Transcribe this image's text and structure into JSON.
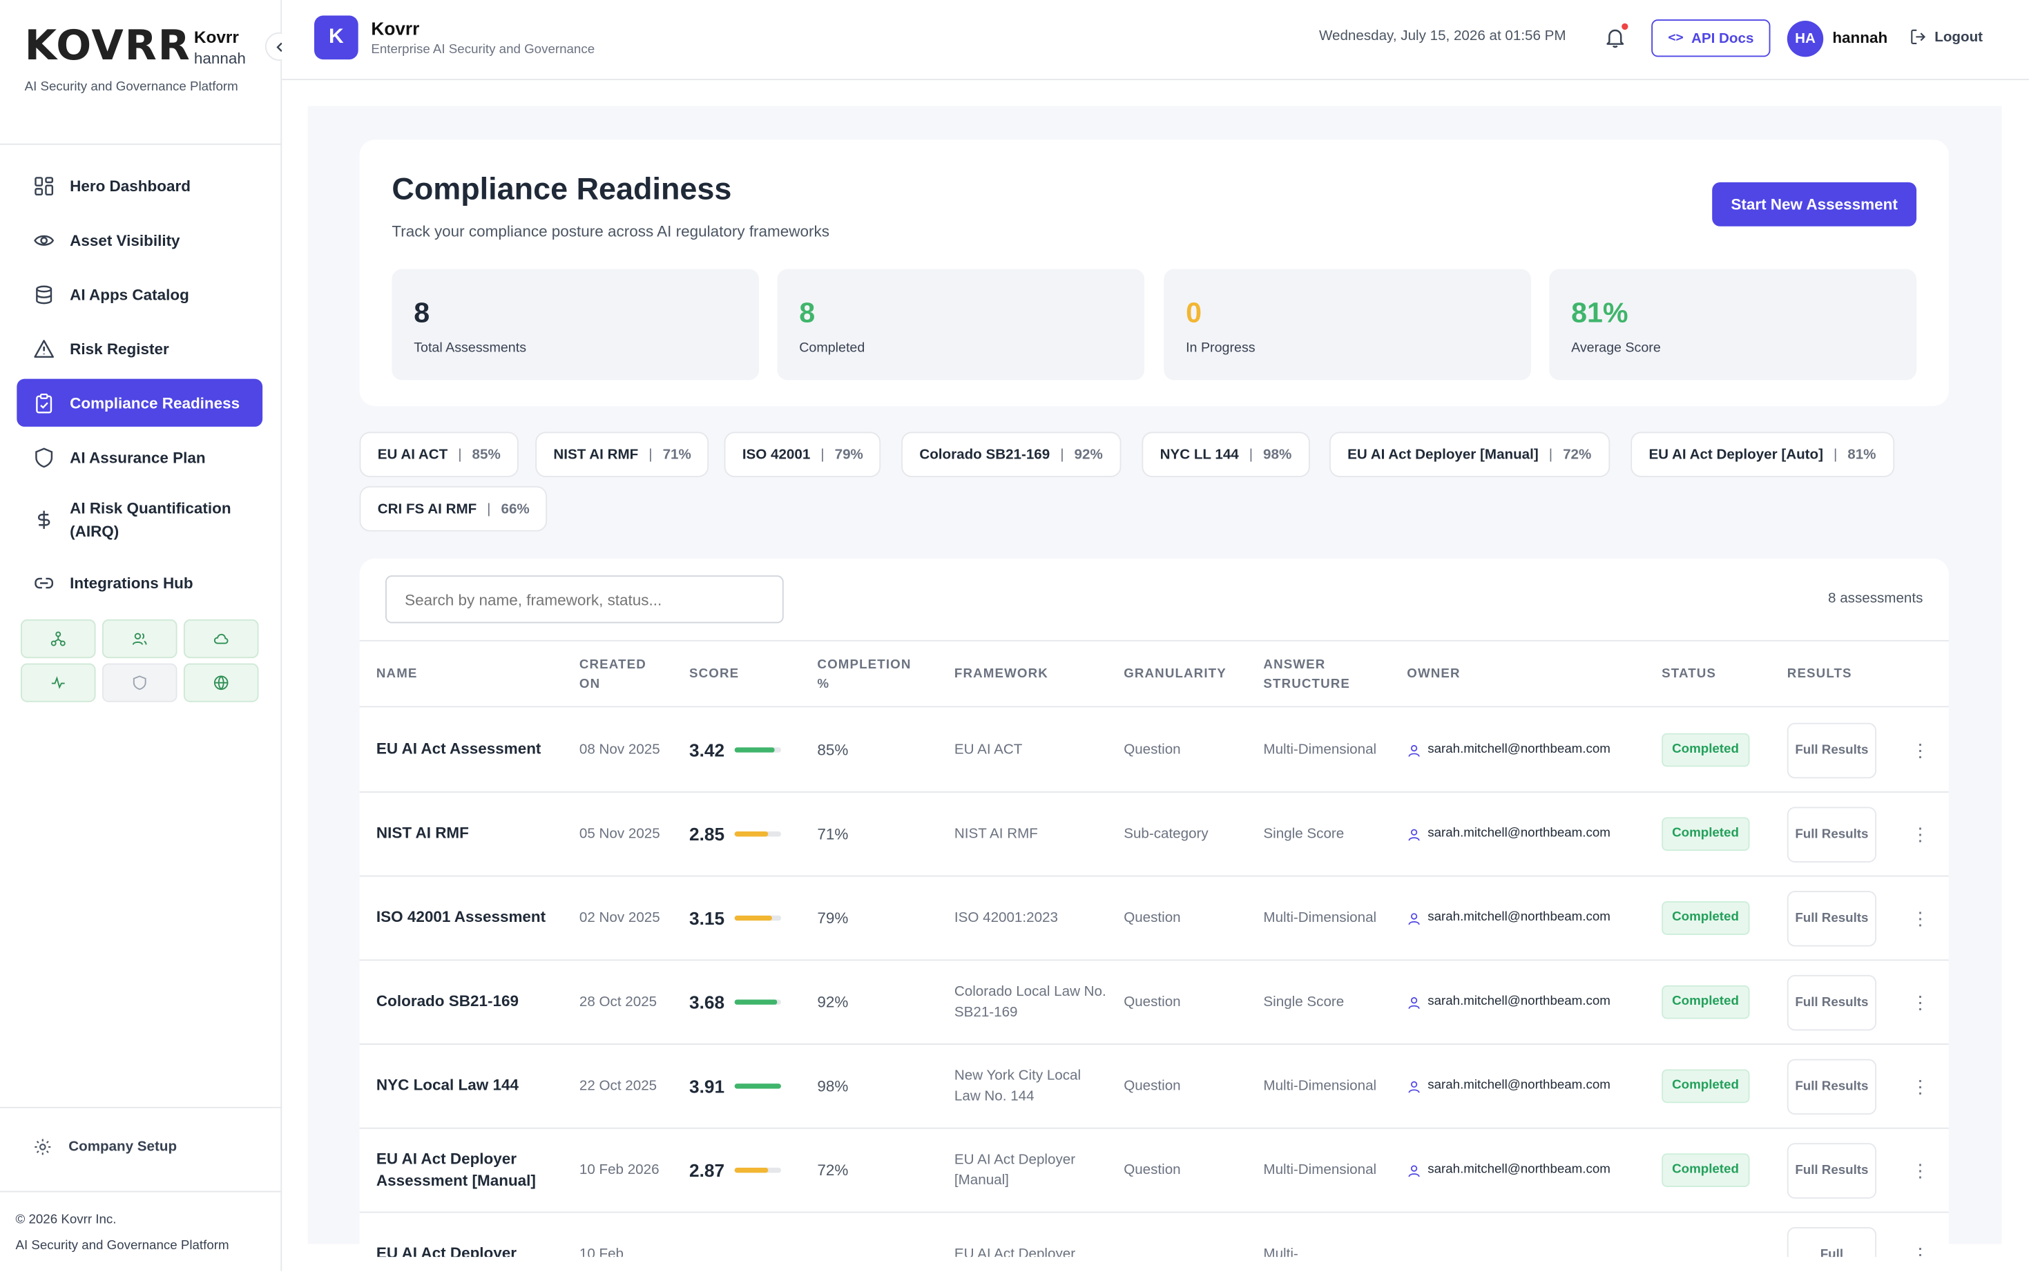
{
  "sidebar": {
    "logo": "KOVRR",
    "org": "Kovrr",
    "user": "hannah",
    "subtitle": "AI Security and Governance Platform",
    "collapse_icon": "chevron-left-icon",
    "items": [
      {
        "label": "Hero Dashboard",
        "icon": "dashboard-icon"
      },
      {
        "label": "Asset Visibility",
        "icon": "eye-icon"
      },
      {
        "label": "AI Apps Catalog",
        "icon": "database-icon"
      },
      {
        "label": "Risk Register",
        "icon": "warning-icon"
      },
      {
        "label": "Compliance Readiness",
        "icon": "clipboard-icon"
      },
      {
        "label": "AI Assurance Plan",
        "icon": "shield-icon"
      },
      {
        "label": "AI Risk Quantification (AIRQ)",
        "icon": "dollar-icon"
      },
      {
        "label": "Integrations Hub",
        "icon": "link-icon"
      }
    ],
    "mini_icons": [
      "network-icon",
      "users-icon",
      "cloud-icon",
      "activity-icon",
      "shield-icon",
      "globe-icon"
    ],
    "company_setup": "Company Setup",
    "footer_copyright": "© 2026 Kovrr Inc.",
    "footer_tagline": "AI Security and Governance Platform"
  },
  "header": {
    "app_initial": "K",
    "app_title": "Kovrr",
    "app_subtitle": "Enterprise AI Security and Governance",
    "datetime": "Wednesday, July 15, 2026 at 01:56 PM",
    "api_docs_icon": "<>",
    "api_docs": "API Docs",
    "avatar_initials": "HA",
    "username": "hannah",
    "logout": "Logout"
  },
  "page": {
    "title": "Compliance Readiness",
    "subtitle": "Track your compliance posture across AI regulatory frameworks",
    "start_button": "Start New Assessment",
    "stats": [
      {
        "value": "8",
        "label": "Total Assessments",
        "color": "#1f2937"
      },
      {
        "value": "8",
        "label": "Completed",
        "color": "#3fb56b"
      },
      {
        "value": "0",
        "label": "In Progress",
        "color": "#f2b632"
      },
      {
        "value": "81%",
        "label": "Average Score",
        "color": "#3fb56b"
      }
    ]
  },
  "frameworks": [
    {
      "name": "EU AI ACT",
      "pct": "85%"
    },
    {
      "name": "NIST AI RMF",
      "pct": "71%"
    },
    {
      "name": "ISO 42001",
      "pct": "79%"
    },
    {
      "name": "Colorado SB21-169",
      "pct": "92%"
    },
    {
      "name": "NYC LL 144",
      "pct": "98%"
    },
    {
      "name": "EU AI Act Deployer [Manual]",
      "pct": "72%"
    },
    {
      "name": "EU AI Act Deployer [Auto]",
      "pct": "81%"
    },
    {
      "name": "CRI FS AI RMF",
      "pct": "66%"
    }
  ],
  "table": {
    "search_placeholder": "Search by name, framework, status...",
    "count": "8 assessments",
    "columns": [
      "NAME",
      "CREATED ON",
      "SCORE",
      "COMPLETION %",
      "FRAMEWORK",
      "GRANULARITY",
      "ANSWER STRUCTURE",
      "OWNER",
      "STATUS",
      "RESULTS"
    ],
    "rows": [
      {
        "name": "EU AI Act Assessment",
        "created": "08 Nov 2025",
        "score": "3.42",
        "score_fraction": 0.855,
        "bar_color": "#3fb56b",
        "completion": "85%",
        "framework": "EU AI ACT",
        "granularity": "Question",
        "structure": "Multi-Dimensional",
        "owner": "sarah.mitchell@northbeam.com",
        "status": "Completed",
        "results": "Full Results"
      },
      {
        "name": "NIST AI RMF",
        "created": "05 Nov 2025",
        "score": "2.85",
        "score_fraction": 0.71,
        "bar_color": "#f2b632",
        "completion": "71%",
        "framework": "NIST AI RMF",
        "granularity": "Sub-category",
        "structure": "Single Score",
        "owner": "sarah.mitchell@northbeam.com",
        "status": "Completed",
        "results": "Full Results"
      },
      {
        "name": "ISO 42001 Assessment",
        "created": "02 Nov 2025",
        "score": "3.15",
        "score_fraction": 0.79,
        "bar_color": "#f2b632",
        "completion": "79%",
        "framework": "ISO 42001:2023",
        "granularity": "Question",
        "structure": "Multi-Dimensional",
        "owner": "sarah.mitchell@northbeam.com",
        "status": "Completed",
        "results": "Full Results"
      },
      {
        "name": "Colorado SB21-169",
        "created": "28 Oct 2025",
        "score": "3.68",
        "score_fraction": 0.92,
        "bar_color": "#3fb56b",
        "completion": "92%",
        "framework": "Colorado Local Law No. SB21-169",
        "granularity": "Question",
        "structure": "Single Score",
        "owner": "sarah.mitchell@northbeam.com",
        "status": "Completed",
        "results": "Full Results"
      },
      {
        "name": "NYC Local Law 144",
        "created": "22 Oct 2025",
        "score": "3.91",
        "score_fraction": 0.98,
        "bar_color": "#3fb56b",
        "completion": "98%",
        "framework": "New York City Local Law No. 144",
        "granularity": "Question",
        "structure": "Multi-Dimensional",
        "owner": "sarah.mitchell@northbeam.com",
        "status": "Completed",
        "results": "Full Results"
      },
      {
        "name": "EU AI Act Deployer Assessment [Manual]",
        "created": "10 Feb 2026",
        "score": "2.87",
        "score_fraction": 0.72,
        "bar_color": "#f2b632",
        "completion": "72%",
        "framework": "EU AI Act Deployer [Manual]",
        "granularity": "Question",
        "structure": "Multi-Dimensional",
        "owner": "sarah.mitchell@northbeam.com",
        "status": "Completed",
        "results": "Full Results"
      },
      {
        "name": "EU AI Act Deployer",
        "created": "10 Feb",
        "score": "",
        "score_fraction": 0,
        "bar_color": "#3fb56b",
        "completion": "",
        "framework": "EU AI Act Deployer",
        "granularity": "",
        "structure": "Multi-",
        "owner": "",
        "status": "",
        "results": "Full"
      }
    ]
  }
}
